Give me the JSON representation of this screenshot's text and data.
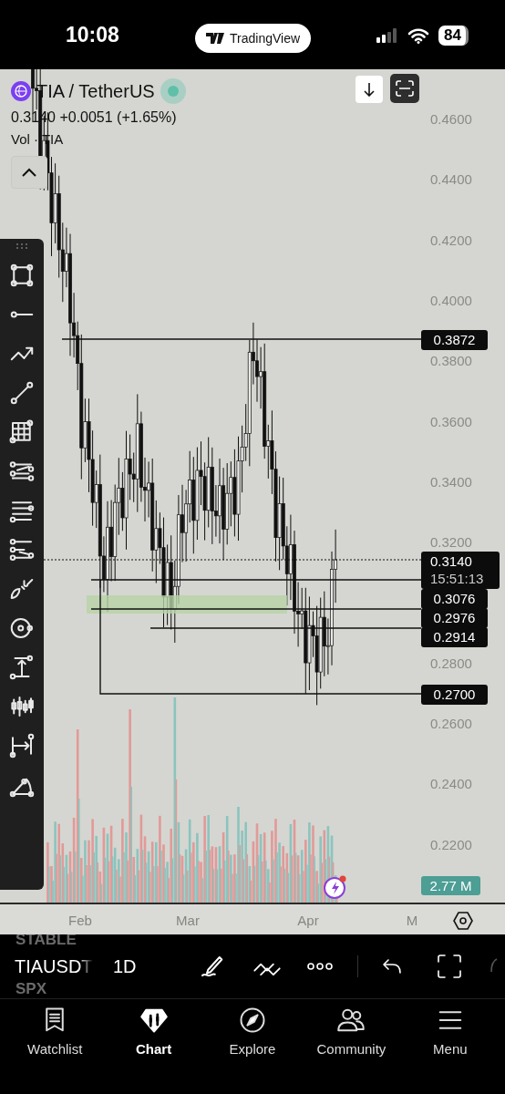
{
  "status_bar": {
    "time": "10:08",
    "app_pill": "TradingView",
    "battery": "84"
  },
  "chart": {
    "symbol": "TIA / TetherUS",
    "price_line": "0.3140 +0.0051 (+1.65%)",
    "volume_label": "Vol · TIA",
    "price_axis": [
      "0.4600",
      "0.4400",
      "0.4200",
      "0.4000",
      "0.3800",
      "0.3600",
      "0.3400",
      "0.3200",
      "0.2800",
      "0.2600",
      "0.2400",
      "0.2200"
    ],
    "level_labels": [
      "0.3872",
      "0.3076",
      "0.2976",
      "0.2914",
      "0.2700"
    ],
    "last_price": {
      "price": "0.3140",
      "countdown": "15:51:13"
    },
    "volume_value": "2.77 M",
    "time_axis": [
      "Feb",
      "Mar",
      "Apr",
      "M"
    ]
  },
  "toolbar": {
    "faded_above": "STABLE",
    "symbol": "TIAUSDT",
    "interval": "1D",
    "faded_below": "SPX"
  },
  "tabs": [
    {
      "label": "Watchlist",
      "selected": false
    },
    {
      "label": "Chart",
      "selected": true
    },
    {
      "label": "Explore",
      "selected": false
    },
    {
      "label": "Community",
      "selected": false
    },
    {
      "label": "Menu",
      "selected": false
    }
  ]
}
